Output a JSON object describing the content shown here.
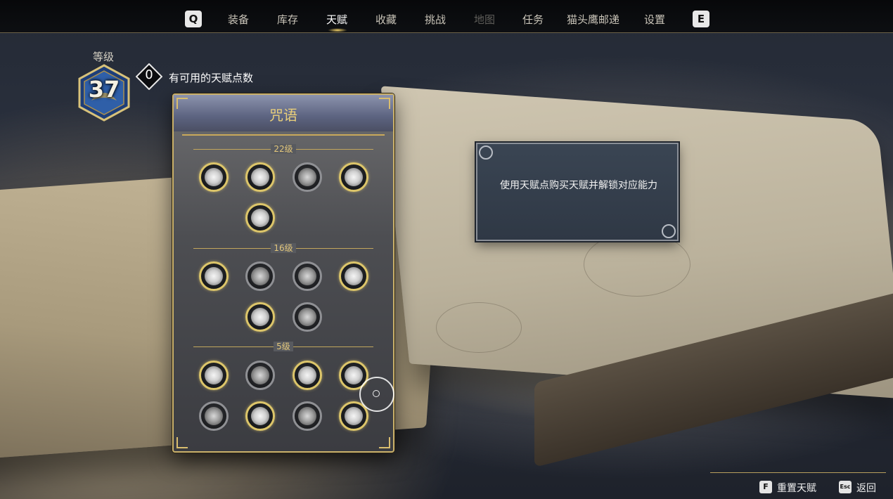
{
  "nav": {
    "left_key": "Q",
    "right_key": "E",
    "tabs": [
      {
        "label": "装备",
        "state": "normal"
      },
      {
        "label": "库存",
        "state": "normal"
      },
      {
        "label": "天赋",
        "state": "active"
      },
      {
        "label": "收藏",
        "state": "normal"
      },
      {
        "label": "挑战",
        "state": "normal"
      },
      {
        "label": "地图",
        "state": "disabled"
      },
      {
        "label": "任务",
        "state": "normal"
      },
      {
        "label": "猫头鹰邮递",
        "state": "normal"
      },
      {
        "label": "设置",
        "state": "normal"
      }
    ]
  },
  "player": {
    "level_label": "等级",
    "level": "37",
    "talent_points": "0",
    "talent_points_label": "有可用的天赋点数"
  },
  "panel": {
    "title": "咒语",
    "tiers": [
      {
        "label": "22级",
        "talents": [
          "gold",
          "gold",
          "grey",
          "gold",
          "gold"
        ]
      },
      {
        "label": "16级",
        "talents": [
          "gold",
          "grey",
          "grey",
          "gold",
          "gold",
          "grey"
        ]
      },
      {
        "label": "5级",
        "talents": [
          "gold",
          "grey",
          "gold",
          "gold",
          "grey",
          "gold",
          "grey",
          "gold"
        ]
      }
    ]
  },
  "tooltip": {
    "text": "使用天赋点购买天赋并解锁对应能力"
  },
  "prompts": [
    {
      "key": "F",
      "label": "重置天赋"
    },
    {
      "key": "Esc",
      "label": "返回"
    }
  ],
  "colors": {
    "accent_gold": "#dcc56a",
    "panel_border": "#c9b06a",
    "nav_bg": "#0d0f12"
  }
}
